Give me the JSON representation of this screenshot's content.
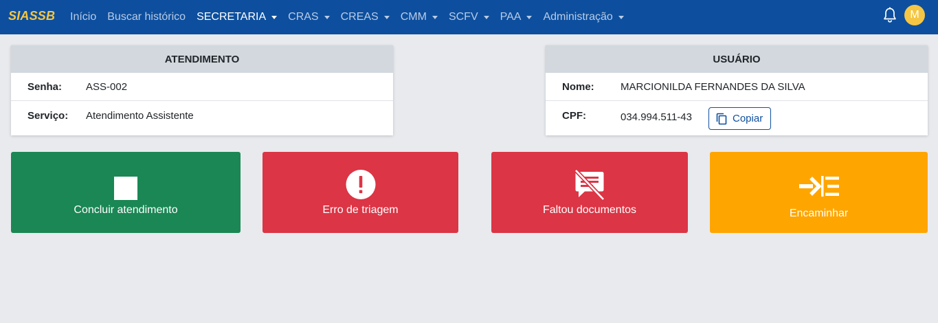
{
  "navbar": {
    "brand": "SIASSB",
    "items": [
      {
        "label": "Início",
        "dropdown": false
      },
      {
        "label": "Buscar histórico",
        "dropdown": false
      },
      {
        "label": "SECRETARIA",
        "dropdown": true
      },
      {
        "label": "CRAS",
        "dropdown": true
      },
      {
        "label": "CREAS",
        "dropdown": true
      },
      {
        "label": "CMM",
        "dropdown": true
      },
      {
        "label": "SCFV",
        "dropdown": true
      },
      {
        "label": "PAA",
        "dropdown": true
      },
      {
        "label": "Administração",
        "dropdown": true
      }
    ],
    "active_item": "SECRETARIA",
    "avatar_initial": "M"
  },
  "atendimento": {
    "title": "ATENDIMENTO",
    "senha_label": "Senha:",
    "senha_value": "ASS-002",
    "servico_label": "Serviço:",
    "servico_value": "Atendimento Assistente"
  },
  "usuario": {
    "title": "USUÁRIO",
    "nome_label": "Nome:",
    "nome_value": "MARCIONILDA FERNANDES DA SILVA",
    "cpf_label": "CPF:",
    "cpf_value": "034.994.511-43",
    "copy_label": "Copiar"
  },
  "actions": [
    {
      "label": "Concluir atendimento",
      "icon": "stop-square-icon",
      "color": "#1a8754"
    },
    {
      "label": "Erro de triagem",
      "icon": "exclamation-circle-icon",
      "color": "#dc3545"
    },
    {
      "label": "Faltou documentos",
      "icon": "no-documents-icon",
      "color": "#dc3545"
    },
    {
      "label": "Encaminhar",
      "icon": "forward-list-icon",
      "color": "#ffa500"
    }
  ],
  "colors": {
    "navbar": "#0d4f9e",
    "brand": "#f5c644",
    "success": "#1a8754",
    "danger": "#dc3545",
    "warning": "#ffa500"
  }
}
